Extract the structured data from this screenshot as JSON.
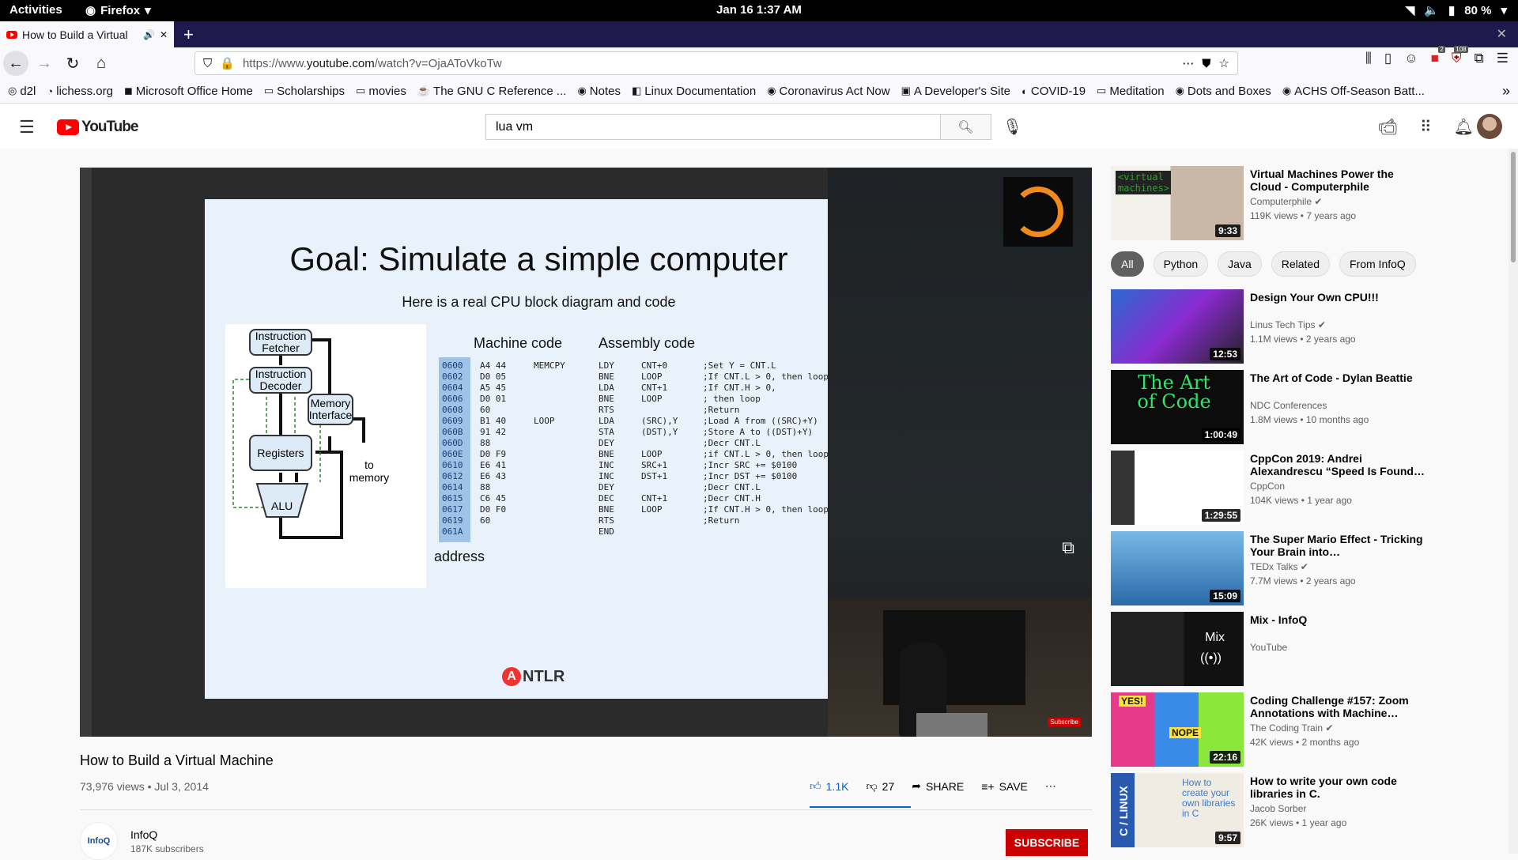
{
  "gnome": {
    "activities": "Activities",
    "app": "Firefox",
    "clock": "Jan 16  1:37 AM",
    "battery": "80 %"
  },
  "browser": {
    "tab_title": "How to Build a Virtual",
    "url_prefix": "https://www.",
    "url_host": "youtube.com",
    "url_path": "/watch?v=OjaAToVkoTw",
    "bookmarks": [
      "d2l",
      "lichess.org",
      "Microsoft Office Home",
      "Scholarships",
      "movies",
      "The GNU C Reference ...",
      "Notes",
      "Linux Documentation",
      "Coronavirus Act Now",
      "A Developer's Site",
      "COVID-19",
      "Meditation",
      "Dots and Boxes",
      "ACHS Off-Season Batt..."
    ],
    "badge_1": "2",
    "badge_2": "108"
  },
  "youtube": {
    "logo": "YouTube",
    "search_value": "lua vm",
    "search_placeholder": "Search"
  },
  "slide": {
    "title": "Goal: Simulate a simple computer",
    "subtitle": "Here is a real CPU block diagram and code",
    "boxes": {
      "fetcher": "Instruction Fetcher",
      "decoder": "Instruction Decoder",
      "memory": "Memory Interface",
      "registers": "Registers",
      "alu": "ALU",
      "to_memory": "to memory"
    },
    "machine_code_head": "Machine code",
    "assembly_head": "Assembly code",
    "address_label": "address",
    "brand": "NTLR",
    "brand_letter": "A",
    "addresses": "0600\n0602\n0604\n0606\n0608\n0609\n060B\n060D\n060E\n0610\n0612\n0614\n0615\n0617\n0619\n061A",
    "machine": "A4 44\nD0 05\nA5 45\nD0 01\n60\nB1 40\n91 42\n88\nD0 F9\nE6 41\nE6 43\n88\nC6 45\nD0 F0\n60",
    "labels": "MEMCPY\n\n\n\n\nLOOP",
    "ops": "LDY\nBNE\nLDA\nBNE\nRTS\nLDA\nSTA\nDEY\nBNE\nINC\nINC\nDEY\nDEC\nBNE\nRTS\nEND",
    "operands": "CNT+0\nLOOP\nCNT+1\nLOOP\n\n(SRC),Y\n(DST),Y\n\nLOOP\nSRC+1\nDST+1\n\nCNT+1\nLOOP",
    "comments": ";Set Y = CNT.L\n;If CNT.L > 0, then loop\n;If CNT.H > 0,\n; then loop\n;Return\n;Load A from ((SRC)+Y)\n;Store A to ((DST)+Y)\n;Decr CNT.L\n;if CNT.L > 0, then loop\n;Incr SRC += $0100\n;Incr DST += $0100\n;Decr CNT.L\n;Decr CNT.H\n;If CNT.H > 0, then loop\n;Return",
    "subscribe_mini": "Subscribe"
  },
  "video": {
    "title": "How to Build a Virtual Machine",
    "meta": "73,976 views • Jul 3, 2014",
    "likes": "1.1K",
    "dislikes": "27",
    "share": "SHARE",
    "save": "SAVE",
    "like_ratio": 0.976
  },
  "channel": {
    "name": "InfoQ",
    "subs": "187K subscribers",
    "avatar_text": "InfoQ",
    "subscribe": "SUBSCRIBE"
  },
  "chips": [
    "All",
    "Python",
    "Java",
    "Related",
    "From InfoQ"
  ],
  "recommendations": [
    {
      "title": "Virtual Machines Power the Cloud - Computerphile",
      "channel": "Computerphile",
      "verified": true,
      "stats": "119K views • 7 years ago",
      "duration": "9:33"
    },
    {
      "title": "Design Your Own CPU!!!",
      "channel": "Linus Tech Tips",
      "verified": true,
      "stats": "1.1M views • 2 years ago",
      "duration": "12:53"
    },
    {
      "title": "The Art of Code - Dylan Beattie",
      "channel": "NDC Conferences",
      "verified": false,
      "stats": "1.8M views • 10 months ago",
      "duration": "1:00:49"
    },
    {
      "title": "CppCon 2019: Andrei Alexandrescu “Speed Is Found…",
      "channel": "CppCon",
      "verified": false,
      "stats": "104K views • 1 year ago",
      "duration": "1:29:55"
    },
    {
      "title": "The Super Mario Effect - Tricking Your Brain into…",
      "channel": "TEDx Talks",
      "verified": true,
      "stats": "7.7M views • 2 years ago",
      "duration": "15:09"
    },
    {
      "title": "Mix - InfoQ",
      "channel": "YouTube",
      "verified": false,
      "stats": "",
      "duration": ""
    },
    {
      "title": "Coding Challenge #157: Zoom Annotations with Machine…",
      "channel": "The Coding Train",
      "verified": true,
      "stats": "42K views • 2 months ago",
      "duration": "22:16"
    },
    {
      "title": "How to write your own code libraries in C.",
      "channel": "Jacob Sorber",
      "verified": false,
      "stats": "26K views • 1 year ago",
      "duration": "9:57"
    }
  ],
  "thumb_text": {
    "vm": "<virtual machines>",
    "art": "The Art of Code",
    "mix": "Mix",
    "libs": "How to create your own libraries in C",
    "linux": "C / LINUX",
    "yes": "YES!",
    "nope": "NOPE"
  },
  "colors": {
    "yt_red": "#ff0000",
    "subscribe_red": "#cc0000",
    "like_blue": "#065fd4",
    "tabstrip": "#1f1a4d"
  }
}
